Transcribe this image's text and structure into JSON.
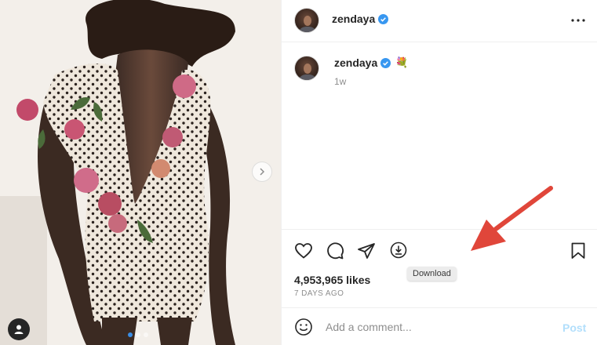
{
  "post": {
    "username": "zendaya",
    "verified": true,
    "caption_emoji": "💐",
    "caption_time": "1w",
    "likes": "4,953,965 likes",
    "date": "7 DAYS AGO",
    "carousel": {
      "total": 3,
      "active_index": 0
    }
  },
  "icons": {
    "more": "more-horizontal-icon",
    "like": "heart-icon",
    "comment": "comment-bubble-icon",
    "share": "paper-plane-icon",
    "download": "download-icon",
    "save": "bookmark-icon",
    "emoji": "smiley-icon",
    "next": "chevron-right-icon",
    "user_tag": "user-icon"
  },
  "tooltip": {
    "download": "Download"
  },
  "comment_box": {
    "placeholder": "Add a comment...",
    "post_label": "Post"
  },
  "colors": {
    "verified": "#3897f0",
    "annotation_arrow": "#e0463a",
    "post_disabled": "#b2dffc"
  }
}
